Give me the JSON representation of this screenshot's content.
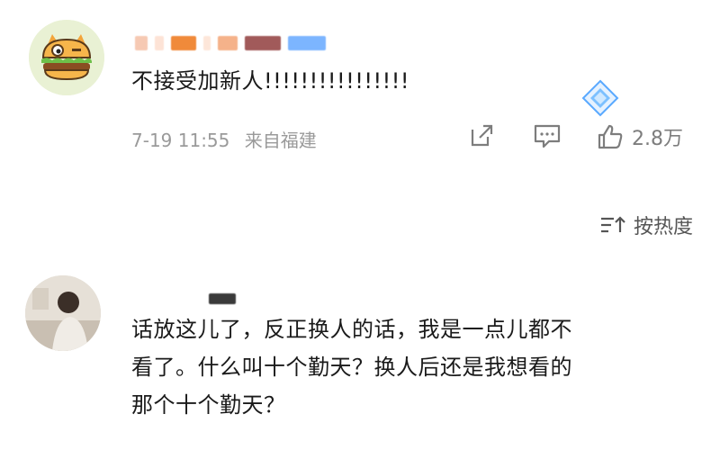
{
  "comments": [
    {
      "text": "不接受加新人!!!!!!!!!!!!!!!!",
      "date": "7-19 11:55",
      "location": "来自福建",
      "likes": "2.8万"
    },
    {
      "text_lines": [
        "话放这儿了，反正换人的话，我是一点儿都不",
        "看了。什么叫十个勤天？换人后还是我想看的",
        "那个十个勤天？"
      ]
    }
  ],
  "sort": {
    "label": "按热度"
  },
  "colors": {
    "meta_gray": "#9a9a9a",
    "icon_gray": "#7d7d7d",
    "badge_blue": "#5aa9ff"
  }
}
